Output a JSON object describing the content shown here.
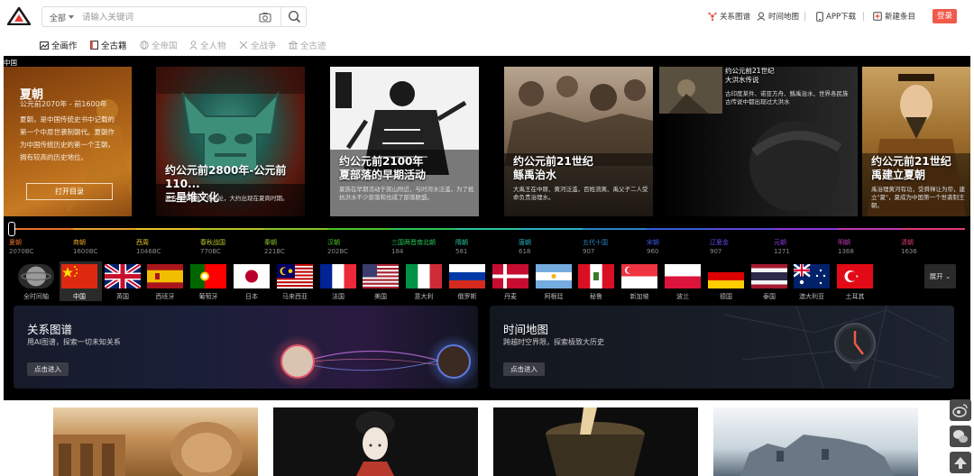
{
  "header": {
    "search_scope": "全部",
    "search_placeholder": "请输入关键词",
    "nav": [
      {
        "label": "关系图谱"
      },
      {
        "label": "时间地图"
      },
      {
        "label": "APP下载"
      },
      {
        "label": "新建条目"
      }
    ],
    "login_label": "登录"
  },
  "subnav": [
    {
      "label": "全画作",
      "active": true
    },
    {
      "label": "全古籍",
      "active": true
    },
    {
      "label": "全帝国",
      "active": false
    },
    {
      "label": "全人物",
      "active": false
    },
    {
      "label": "全战争",
      "active": false
    },
    {
      "label": "全古迹",
      "active": false
    }
  ],
  "region_label": "中国",
  "intro": {
    "title": "夏朝",
    "years": "公元前2070年 - 前1600年",
    "text": "夏朝，是中国传统史书中记载的第一个中原世袭制朝代。夏朝作为中国传统历史的第一个王朝，拥有较高的历史地位。",
    "button": "打开目录"
  },
  "cards": [
    {
      "title": "约公元前2800年-公元前110...\n三星堆文化",
      "desc": "著名的青铜器文化遗址，大约出现在夏商时期。"
    },
    {
      "title": "约公元前2100年\n夏部落的早期活动",
      "desc": "夏族在早期活动于嵩山附近，与时河水泛滥，为了抵抗洪水不少部落和也成了部落联盟。"
    },
    {
      "title": "约公元前21世纪\n鲧禹治水",
      "desc": "大禹王在中原、黄河泛滥，百姓流离、禹父子二人受命负责治理水。"
    },
    {
      "title": "约公元前21世纪\n大洪水传说",
      "desc": "古印度某件、诺亚方舟、鲧禹治水、世界各民族古传说中都出现过大洪水"
    },
    {
      "title": "约公元前21世纪\n禹建立夏朝",
      "desc": "禹治理黄河有功，受舜禅让为帝，建立\"夏\"，夏成为中国第一个世袭制王朝。"
    }
  ],
  "timeline": [
    {
      "name": "夏朝",
      "year": "2070BC",
      "color": "#e8722a"
    },
    {
      "name": "商朝",
      "year": "1600BC",
      "color": "#e6a32a"
    },
    {
      "name": "西周",
      "year": "1046BC",
      "color": "#e6c42a"
    },
    {
      "name": "春秋战国",
      "year": "770BC",
      "color": "#b8c42a"
    },
    {
      "name": "秦朝",
      "year": "221BC",
      "color": "#8ac42a"
    },
    {
      "name": "汉朝",
      "year": "202BC",
      "color": "#4ac42a"
    },
    {
      "name": "三国两晋南北朝",
      "year": "184",
      "color": "#2ac45a"
    },
    {
      "name": "隋朝",
      "year": "581",
      "color": "#2ac4a0"
    },
    {
      "name": "唐朝",
      "year": "618",
      "color": "#2ab0c4"
    },
    {
      "name": "五代十国",
      "year": "907",
      "color": "#2a84c4"
    },
    {
      "name": "宋朝",
      "year": "960",
      "color": "#3a5ae0"
    },
    {
      "name": "辽夏金",
      "year": "907",
      "color": "#5a48e0"
    },
    {
      "name": "元朝",
      "year": "1271",
      "color": "#8a3ae0"
    },
    {
      "name": "明朝",
      "year": "1368",
      "color": "#c03ab0"
    },
    {
      "name": "清朝",
      "year": "1636",
      "color": "#e03a7a"
    }
  ],
  "countries": [
    {
      "name": "全时间轴",
      "flag": "globe"
    },
    {
      "name": "中国",
      "flag": "cn"
    },
    {
      "name": "英国",
      "flag": "gb"
    },
    {
      "name": "西班牙",
      "flag": "es"
    },
    {
      "name": "葡萄牙",
      "flag": "pt"
    },
    {
      "name": "日本",
      "flag": "jp"
    },
    {
      "name": "马来西亚",
      "flag": "my"
    },
    {
      "name": "法国",
      "flag": "fr"
    },
    {
      "name": "美国",
      "flag": "us"
    },
    {
      "name": "意大利",
      "flag": "it"
    },
    {
      "name": "俄罗斯",
      "flag": "ru"
    },
    {
      "name": "丹麦",
      "flag": "dk"
    },
    {
      "name": "阿根廷",
      "flag": "ar"
    },
    {
      "name": "秘鲁",
      "flag": "pe"
    },
    {
      "name": "新加坡",
      "flag": "sg"
    },
    {
      "name": "波兰",
      "flag": "pl"
    },
    {
      "name": "德国",
      "flag": "de"
    },
    {
      "name": "泰国",
      "flag": "th"
    },
    {
      "name": "澳大利亚",
      "flag": "au"
    },
    {
      "name": "土耳其",
      "flag": "tr"
    }
  ],
  "expand_label": "展开",
  "panels": [
    {
      "title": "关系图谱",
      "subtitle": "用AI图谱，探索一切未知关系",
      "button": "点击进入"
    },
    {
      "title": "时间地图",
      "subtitle": "跨越时空界限，探索极致大历史",
      "button": "点击进入"
    }
  ],
  "colors": {
    "accent": "#f15a4a",
    "band": "#000000",
    "intro_card": "#a35a14"
  },
  "side_icons": [
    "weibo-icon",
    "wechat-icon",
    "back-to-top-icon"
  ]
}
